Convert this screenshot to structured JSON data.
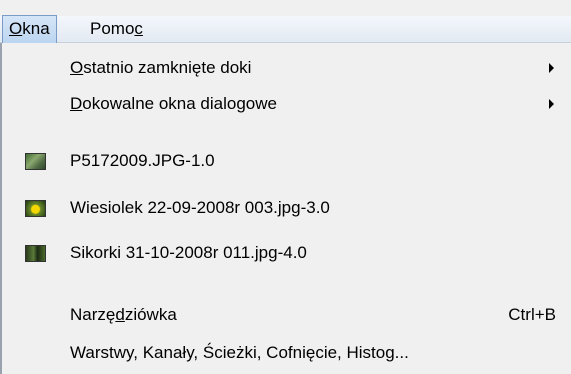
{
  "menubar": {
    "items": [
      {
        "label_pre": "",
        "label_u": "O",
        "label_post": "kna",
        "open": true
      },
      {
        "label_pre": "Pomo",
        "label_u": "c",
        "label_post": "",
        "open": false
      }
    ]
  },
  "menu": {
    "items": [
      {
        "pre": "",
        "u": "O",
        "post": "statnio zamknięte doki",
        "submenu": true
      },
      {
        "pre": "",
        "u": "D",
        "post": "okowalne okna dialogowe",
        "submenu": true
      },
      {
        "label": "P5172009.JPG-1.0",
        "icon": "image-thumbnail-icon"
      },
      {
        "label": "Wiesiolek 22-09-2008r 003.jpg-3.0",
        "icon": "image-thumbnail-icon"
      },
      {
        "label": "Sikorki 31-10-2008r 011.jpg-4.0",
        "icon": "image-thumbnail-icon"
      },
      {
        "pre": "Narzę",
        "u": "d",
        "post": "ziówka",
        "shortcut": "Ctrl+B"
      },
      {
        "label": "Warstwy, Kanały, Ścieżki, Cofnięcie, Histog..."
      }
    ]
  }
}
